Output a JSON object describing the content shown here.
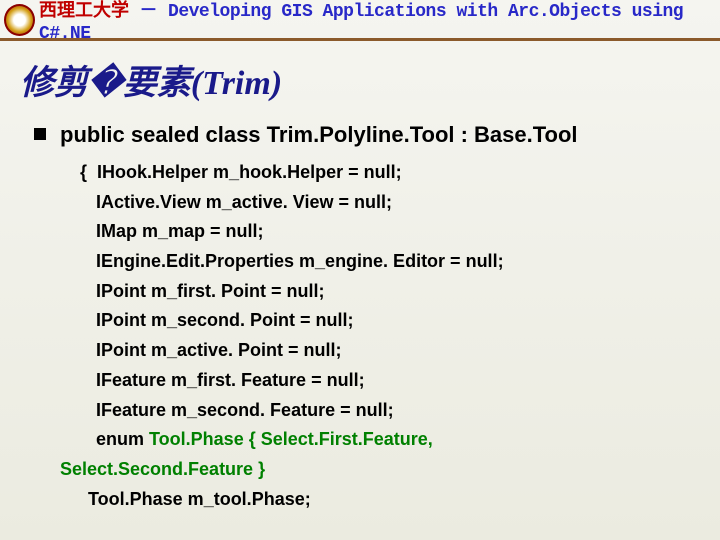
{
  "header": {
    "logo_letter": "",
    "cn": "西理工大学",
    "dash": "－",
    "en": "Developing GIS Applications with Arc.Objects using C#.NE"
  },
  "title": "修剪�要素(Trim)",
  "class_declaration": "public sealed class Trim.Polyline.Tool : Base.Tool",
  "code": {
    "brace": "{",
    "lines": [
      "IHook.Helper m_hook.Helper = null;",
      "IActive.View m_active. View = null;",
      "IMap m_map = null;",
      "IEngine.Edit.Properties m_engine. Editor = null;",
      "IPoint m_first. Point = null;",
      "IPoint m_second. Point = null;",
      "IPoint m_active. Point = null;",
      "IFeature m_first. Feature = null;",
      "IFeature m_second. Feature = null;"
    ],
    "enum_kw": "enum",
    "enum_body": " Tool.Phase { Select.First.Feature,",
    "enum_cont": "Select.Second.Feature }",
    "last": "Tool.Phase m_tool.Phase;"
  }
}
